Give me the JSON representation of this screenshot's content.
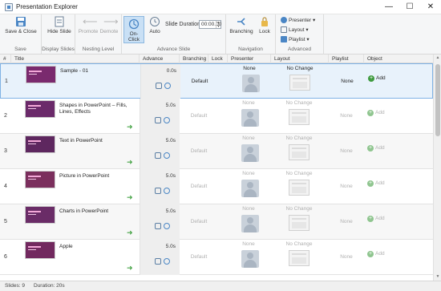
{
  "window": {
    "title": "Presentation Explorer",
    "minimize": "—",
    "maximize": "☐",
    "close": "✕"
  },
  "ribbon": {
    "save": {
      "button": "Save & Close",
      "group": "Save"
    },
    "display": {
      "button": "Hide Slide",
      "group": "Display Slides"
    },
    "nesting": {
      "promote": "Promote",
      "demote": "Demote",
      "group": "Nesting Level"
    },
    "advance": {
      "onclick": "On-Click",
      "auto": "Auto",
      "duration_label": "Slide Duration:",
      "duration_value": "00:00.00",
      "group": "Advance Slide"
    },
    "navigation": {
      "branching": "Branching",
      "lock": "Lock",
      "group": "Navigation"
    },
    "advanced": {
      "presenter": "Presenter ▾",
      "layout": "Layout ▾",
      "playlist": "Playlist ▾",
      "group": "Advanced"
    }
  },
  "columns": [
    "#",
    "Title",
    "Advance",
    "Branching",
    "Lock",
    "Presenter",
    "Layout",
    "Playlist",
    "Object"
  ],
  "rows": [
    {
      "num": "1",
      "title": "Sample - 01",
      "advance": "0.0s",
      "branching": "Default",
      "presenter": "None",
      "layout": "No Change",
      "playlist": "None",
      "object": "Add",
      "thumb_color": "#7a2a6e"
    },
    {
      "num": "2",
      "title": "Shapes in PowerPoint – Fills, Lines, Effects",
      "advance": "5.0s",
      "branching": "Default",
      "presenter": "None",
      "layout": "No Change",
      "playlist": "None",
      "object": "Add",
      "thumb_color": "#6b2a6a"
    },
    {
      "num": "3",
      "title": "Text in PowerPoint",
      "advance": "5.0s",
      "branching": "Default",
      "presenter": "None",
      "layout": "No Change",
      "playlist": "None",
      "object": "Add",
      "thumb_color": "#5e275f"
    },
    {
      "num": "4",
      "title": "Picture in PowerPoint",
      "advance": "5.0s",
      "branching": "Default",
      "presenter": "None",
      "layout": "No Change",
      "playlist": "None",
      "object": "Add",
      "thumb_color": "#7b2f5d"
    },
    {
      "num": "5",
      "title": "Charts in PowerPoint",
      "advance": "5.0s",
      "branching": "Default",
      "presenter": "None",
      "layout": "No Change",
      "playlist": "None",
      "object": "Add",
      "thumb_color": "#6a2c67"
    },
    {
      "num": "6",
      "title": "Apple",
      "advance": "5.0s",
      "branching": "Default",
      "presenter": "None",
      "layout": "No Change",
      "playlist": "None",
      "object": "Add",
      "thumb_color": "#72295f"
    }
  ],
  "status": {
    "slides": "Slides: 9",
    "duration": "Duration: 20s"
  },
  "colors": {
    "accent": "#4a86c5",
    "add_green": "#3e9a3e",
    "selection": "#e8f2fb"
  }
}
